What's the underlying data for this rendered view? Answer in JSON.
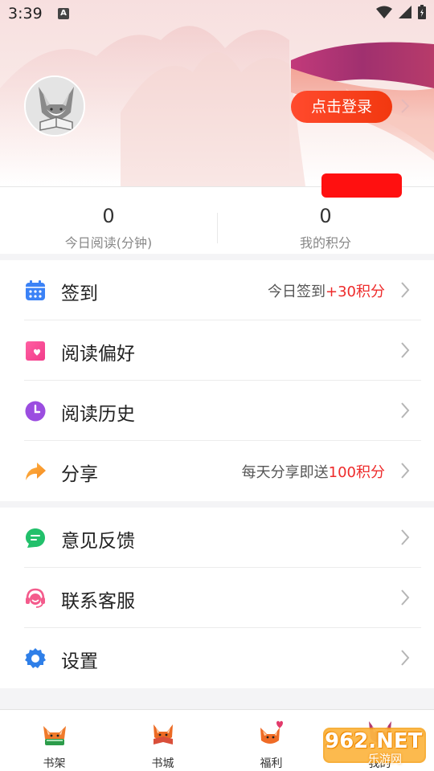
{
  "status_bar": {
    "time": "3:39",
    "notification_badge": "A"
  },
  "profile": {
    "login_label": "点击登录"
  },
  "stats": [
    {
      "value": "0",
      "label": "今日阅读(分钟)"
    },
    {
      "value": "0",
      "label": "我的积分"
    }
  ],
  "menu1": [
    {
      "label": "签到",
      "extra_prefix": "今日签到",
      "extra_highlight": "+30积分",
      "icon": "calendar-icon"
    },
    {
      "label": "阅读偏好",
      "extra_prefix": "",
      "extra_highlight": "",
      "icon": "heart-card-icon"
    },
    {
      "label": "阅读历史",
      "extra_prefix": "",
      "extra_highlight": "",
      "icon": "clock-icon"
    },
    {
      "label": "分享",
      "extra_prefix": "每天分享即送",
      "extra_highlight": "100积分",
      "icon": "share-arrow-icon"
    }
  ],
  "menu2": [
    {
      "label": "意见反馈",
      "icon": "feedback-bubble-icon"
    },
    {
      "label": "联系客服",
      "icon": "customer-service-icon"
    },
    {
      "label": "设置",
      "icon": "gear-icon"
    }
  ],
  "tabs": [
    {
      "label": "书架",
      "icon": "fox-bookshelf-icon"
    },
    {
      "label": "书城",
      "icon": "fox-bookstore-icon"
    },
    {
      "label": "福利",
      "icon": "fox-welfare-icon"
    },
    {
      "label": "我的",
      "icon": "fox-profile-icon"
    }
  ],
  "watermark": {
    "text": "962.NET",
    "sub": "乐游网"
  },
  "colors": {
    "accent": "#f2380f",
    "highlight": "#ee2b2b"
  }
}
